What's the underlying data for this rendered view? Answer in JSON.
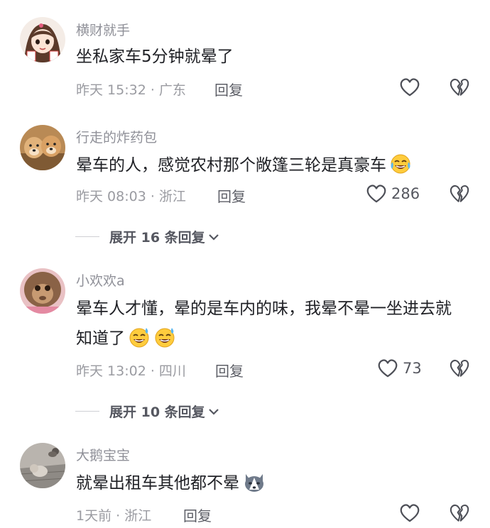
{
  "comments": [
    {
      "username": "横财就手",
      "text": "坐私家车5分钟就晕了",
      "time_location": "昨天 15:32 · 广东",
      "reply_label": "回复",
      "likes": ""
    },
    {
      "username": "行走的炸药包",
      "text": "晕车的人，感觉农村那个敞篷三轮是真豪车",
      "time_location": "昨天 08:03 · 浙江",
      "reply_label": "回复",
      "likes": "286",
      "expand_label": "展开 16 条回复"
    },
    {
      "username": "小欢欢a",
      "text": "晕车人才懂，晕的是车内的味，我晕不晕一坐进去就知道了",
      "time_location": "昨天 13:02 · 四川",
      "reply_label": "回复",
      "likes": "73",
      "expand_label": "展开 10 条回复"
    },
    {
      "username": "大鹅宝宝",
      "text": "就晕出租车其他都不晕",
      "time_location": "1天前 · 浙江",
      "reply_label": "回复",
      "likes": ""
    }
  ],
  "icons": {
    "like": "heart-outline-icon",
    "dislike": "broken-heart-icon",
    "expand": "chevron-down-icon",
    "emoji_laugh_cry": "laugh-cry-emoji",
    "emoji_sweat_smile": "sweat-smile-emoji",
    "emoji_husky": "husky-emoji"
  }
}
